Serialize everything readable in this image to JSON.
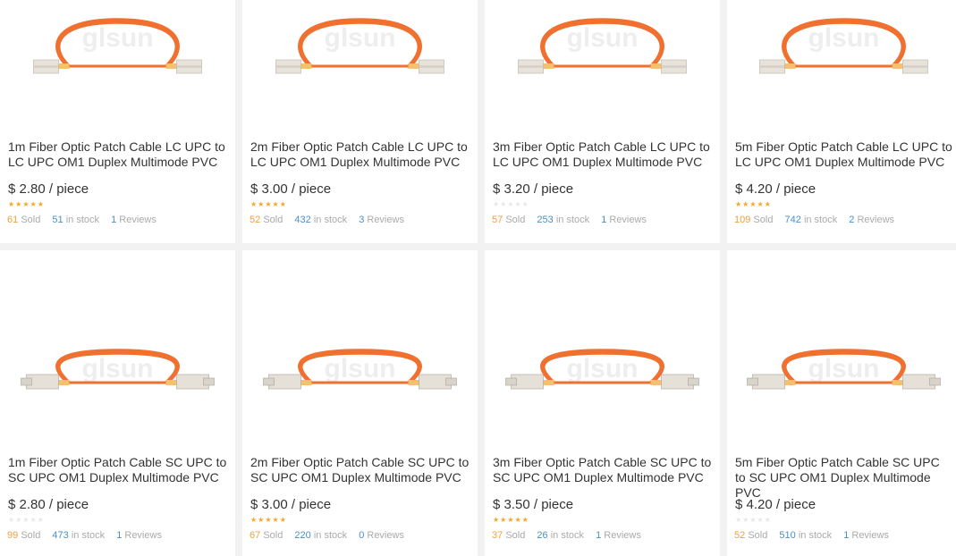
{
  "colors": {
    "cable": "#f07030",
    "star_on": "#f5a623",
    "sold": "#f0a040",
    "stock": "#4a90c8"
  },
  "watermark": "glsun",
  "products": [
    {
      "title": "1m Fiber Optic Patch Cable LC UPC to LC UPC OM1 Duplex Multimode PVC",
      "price": "$ 2.80 / piece",
      "rating": 5,
      "sold": "61",
      "sold_label": "Sold",
      "stock": "51",
      "stock_label": "in stock",
      "reviews": "1",
      "reviews_label": "Reviews",
      "connector": "LC"
    },
    {
      "title": "2m Fiber Optic Patch Cable LC UPC to LC UPC OM1 Duplex Multimode PVC",
      "price": "$ 3.00 / piece",
      "rating": 5,
      "sold": "52",
      "sold_label": "Sold",
      "stock": "432",
      "stock_label": "in stock",
      "reviews": "3",
      "reviews_label": "Reviews",
      "connector": "LC"
    },
    {
      "title": "3m Fiber Optic Patch Cable LC UPC to LC UPC OM1 Duplex Multimode PVC",
      "price": "$ 3.20 / piece",
      "rating": 0,
      "sold": "57",
      "sold_label": "Sold",
      "stock": "253",
      "stock_label": "in stock",
      "reviews": "1",
      "reviews_label": "Reviews",
      "connector": "LC"
    },
    {
      "title": "5m Fiber Optic Patch Cable LC UPC to LC UPC OM1 Duplex Multimode PVC",
      "price": "$ 4.20 / piece",
      "rating": 5,
      "sold": "109",
      "sold_label": "Sold",
      "stock": "742",
      "stock_label": "in stock",
      "reviews": "2",
      "reviews_label": "Reviews",
      "connector": "LC"
    },
    {
      "title": "1m Fiber Optic Patch Cable SC UPC to SC UPC OM1 Duplex Multimode PVC",
      "price": "$ 2.80 / piece",
      "rating": 0,
      "sold": "99",
      "sold_label": "Sold",
      "stock": "473",
      "stock_label": "in stock",
      "reviews": "1",
      "reviews_label": "Reviews",
      "connector": "SC"
    },
    {
      "title": "2m Fiber Optic Patch Cable SC UPC to SC UPC OM1 Duplex Multimode PVC",
      "price": "$ 3.00 / piece",
      "rating": 5,
      "sold": "67",
      "sold_label": "Sold",
      "stock": "220",
      "stock_label": "in stock",
      "reviews": "0",
      "reviews_label": "Reviews",
      "connector": "SC"
    },
    {
      "title": "3m Fiber Optic Patch Cable SC UPC to SC UPC OM1 Duplex Multimode PVC",
      "price": "$ 3.50 / piece",
      "rating": 5,
      "sold": "37",
      "sold_label": "Sold",
      "stock": "26",
      "stock_label": "in stock",
      "reviews": "1",
      "reviews_label": "Reviews",
      "connector": "SC"
    },
    {
      "title": "5m Fiber Optic Patch Cable SC UPC to SC UPC OM1 Duplex Multimode PVC",
      "price": "$ 4.20 / piece",
      "rating": 0,
      "sold": "52",
      "sold_label": "Sold",
      "stock": "510",
      "stock_label": "in stock",
      "reviews": "1",
      "reviews_label": "Reviews",
      "connector": "SC"
    }
  ]
}
